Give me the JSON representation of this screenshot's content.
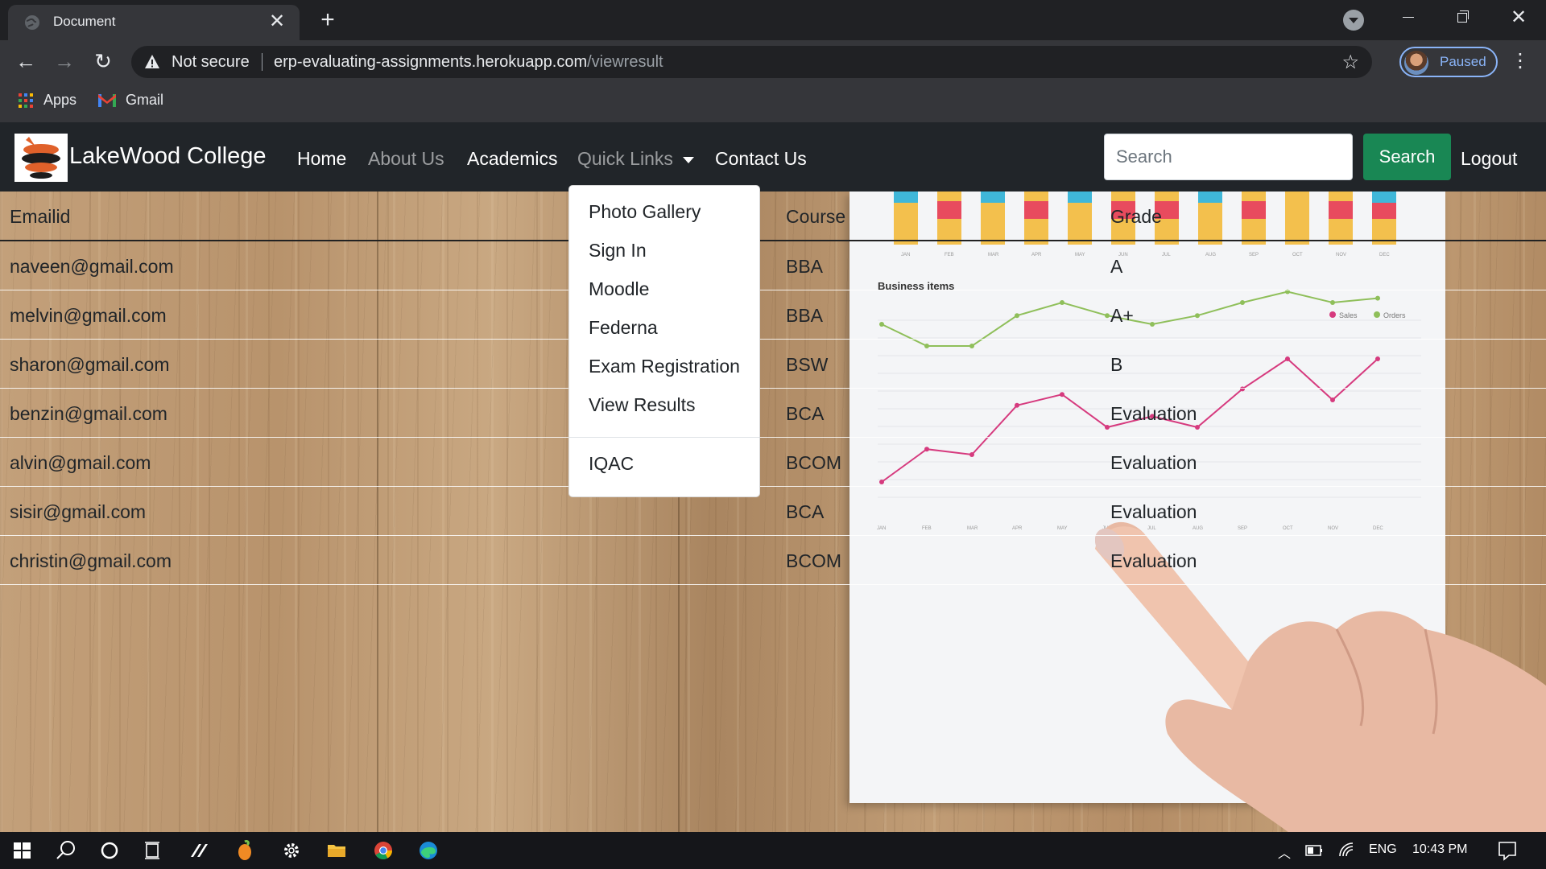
{
  "browser": {
    "tab_title": "Document",
    "tab_close": "✕",
    "new_tab": "+",
    "security_label": "Not secure",
    "url_host": "erp-evaluating-assignments.herokuapp.com",
    "url_path": "/viewresult",
    "profile_status": "Paused",
    "bookmarks": [
      {
        "label": "Apps",
        "icon": "apps-grid-icon"
      },
      {
        "label": "Gmail",
        "icon": "gmail-icon"
      }
    ]
  },
  "navbar": {
    "brand": "LakeWood College",
    "links": [
      {
        "label": "Home",
        "active": true
      },
      {
        "label": "About Us",
        "active": false
      },
      {
        "label": "Academics",
        "active": true
      },
      {
        "label": "Quick Links",
        "dropdown": true
      },
      {
        "label": "Contact Us",
        "active": true
      }
    ],
    "search_placeholder": "Search",
    "search_button": "Search",
    "logout": "Logout"
  },
  "dropdown": {
    "items": [
      "Photo Gallery",
      "Sign In",
      "Moodle",
      "Federna",
      "Exam Registration",
      "View Results"
    ],
    "extra_item": "IQAC"
  },
  "results": {
    "headers": {
      "email": "Emailid",
      "course": "Course",
      "grade": "Grade"
    },
    "rows": [
      {
        "email": "naveen@gmail.com",
        "course": "BBA",
        "grade": "A"
      },
      {
        "email": "melvin@gmail.com",
        "course": "BBA",
        "grade": "A+"
      },
      {
        "email": "sharon@gmail.com",
        "course": "BSW",
        "grade": "B"
      },
      {
        "email": "benzin@gmail.com",
        "course": "BCA",
        "grade": "Evaluation"
      },
      {
        "email": "alvin@gmail.com",
        "course": "BCOM",
        "grade": "Evaluation"
      },
      {
        "email": "sisir@gmail.com",
        "course": "BCA",
        "grade": "Evaluation"
      },
      {
        "email": "christin@gmail.com",
        "course": "BCOM",
        "grade": "Evaluation"
      }
    ]
  },
  "background_chart": {
    "title": "Business items",
    "legend": [
      "Sales",
      "Orders"
    ],
    "months": [
      "JAN",
      "FEB",
      "MAR",
      "APR",
      "MAY",
      "JUN",
      "JUL",
      "AUG",
      "SEP",
      "OCT",
      "NOV",
      "DEC"
    ],
    "colors": {
      "sales": "#d63a7e",
      "orders": "#8fbf5a"
    }
  },
  "taskbar": {
    "language": "ENG",
    "time": "10:43 PM"
  },
  "colors": {
    "navbar_bg": "#212529",
    "search_button": "#198754",
    "chrome_bg": "#202124",
    "link_accent": "#8ab4f8"
  }
}
